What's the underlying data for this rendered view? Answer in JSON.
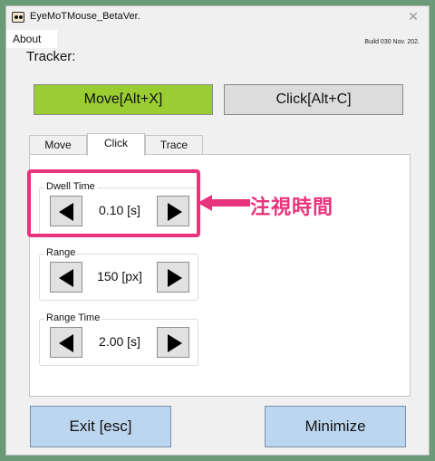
{
  "window": {
    "title": "EyeMoTMouse_BetaVer.",
    "close_glyph": "✕"
  },
  "menu": {
    "about": "About"
  },
  "build": "Build 030 Nov. 202.",
  "tracker_label": "Tracker:",
  "mode_buttons": {
    "move": "Move[Alt+X]",
    "click": "Click[Alt+C]",
    "move_color": "#9acd32"
  },
  "tabs": [
    {
      "label": "Move"
    },
    {
      "label": "Click"
    },
    {
      "label": "Trace"
    }
  ],
  "active_tab": "Click",
  "settings": [
    {
      "label": "Dwell Time",
      "value": "0.10 [s]"
    },
    {
      "label": "Range",
      "value": "150 [px]"
    },
    {
      "label": "Range Time",
      "value": "2.00 [s]"
    }
  ],
  "annotation": {
    "text": "注視時間",
    "color": "#e8337d"
  },
  "bottom_buttons": {
    "exit": "Exit [esc]",
    "minimize": "Minimize",
    "color": "#bdd6f0"
  },
  "icons": {
    "app": "eye-mascot-icon",
    "decrease": "triangle-left-icon",
    "increase": "triangle-right-icon"
  }
}
